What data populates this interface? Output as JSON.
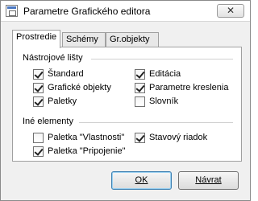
{
  "window": {
    "title": "Parametre Grafického editora",
    "close_glyph": "✕"
  },
  "tabs": [
    {
      "label": "Prostredie",
      "active": true
    },
    {
      "label": "Schémy",
      "active": false
    },
    {
      "label": "Gr.objekty",
      "active": false
    }
  ],
  "groups": {
    "tools": {
      "label": "Nástrojové lišty",
      "items": [
        {
          "label": "Štandard",
          "checked": true
        },
        {
          "label": "Grafické objekty",
          "checked": true
        },
        {
          "label": "Paletky",
          "checked": true
        },
        {
          "label": "Editácia",
          "checked": true
        },
        {
          "label": "Parametre kreslenia",
          "checked": true
        },
        {
          "label": "Slovník",
          "checked": false
        }
      ]
    },
    "other": {
      "label": "Iné elementy",
      "items": [
        {
          "label": "Paletka \"Vlastnosti\"",
          "checked": false
        },
        {
          "label": "Paletka \"Pripojenie\"",
          "checked": true
        },
        {
          "label": "Stavový riadok",
          "checked": true
        }
      ]
    }
  },
  "buttons": {
    "ok": "OK",
    "back": "Návrat"
  }
}
